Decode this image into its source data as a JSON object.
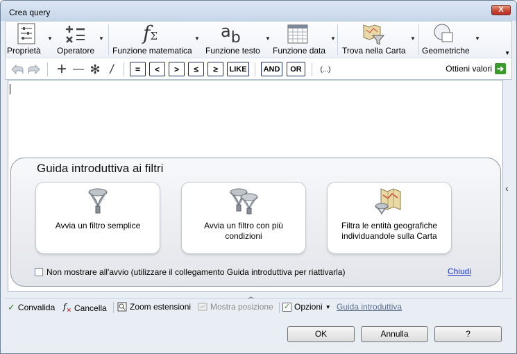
{
  "window": {
    "title": "Crea query",
    "close_glyph": "X"
  },
  "ribbon": {
    "items": [
      {
        "label": "Proprietà",
        "icon": "properties-icon"
      },
      {
        "label": "Operatore",
        "icon": "operator-icon"
      },
      {
        "label": "Funzione matematica",
        "icon": "math-function-icon"
      },
      {
        "label": "Funzione testo",
        "icon": "text-function-icon"
      },
      {
        "label": "Funzione data",
        "icon": "date-function-icon"
      },
      {
        "label": "Trova nella Carta",
        "icon": "find-in-map-icon"
      },
      {
        "label": "Geometriche",
        "icon": "geometry-icon"
      }
    ],
    "math_glyph": "f",
    "math_sub": "Σ",
    "text_glyph_a": "a",
    "text_glyph_b": "b"
  },
  "toolbar": {
    "operators": [
      "=",
      "<",
      ">",
      "≤",
      "≥",
      "LIKE"
    ],
    "logic": [
      "AND",
      "OR"
    ],
    "ellipsis": "(...)",
    "get_values_label": "Ottieni valori",
    "plus": "+",
    "minus": "—",
    "asterisk": "✻",
    "slash": "/"
  },
  "guide": {
    "title": "Guida introduttiva ai filtri",
    "cards": [
      "Avvia un filtro semplice",
      "Avvia un filtro con più condizioni",
      "Filtra le entità geografiche individuandole sulla Carta"
    ],
    "dont_show": "Non mostrare all'avvio (utilizzare il collegamento Guida introduttiva per riattivarla)",
    "close": "Chiudi"
  },
  "status": {
    "validate": "Convalida",
    "clear": "Cancella",
    "zoom": "Zoom estensioni",
    "show_position": "Mostra posizione",
    "options": "Opzioni",
    "guide_link": "Guida introduttiva"
  },
  "buttons": {
    "ok": "OK",
    "cancel": "Annulla",
    "help": "?"
  }
}
